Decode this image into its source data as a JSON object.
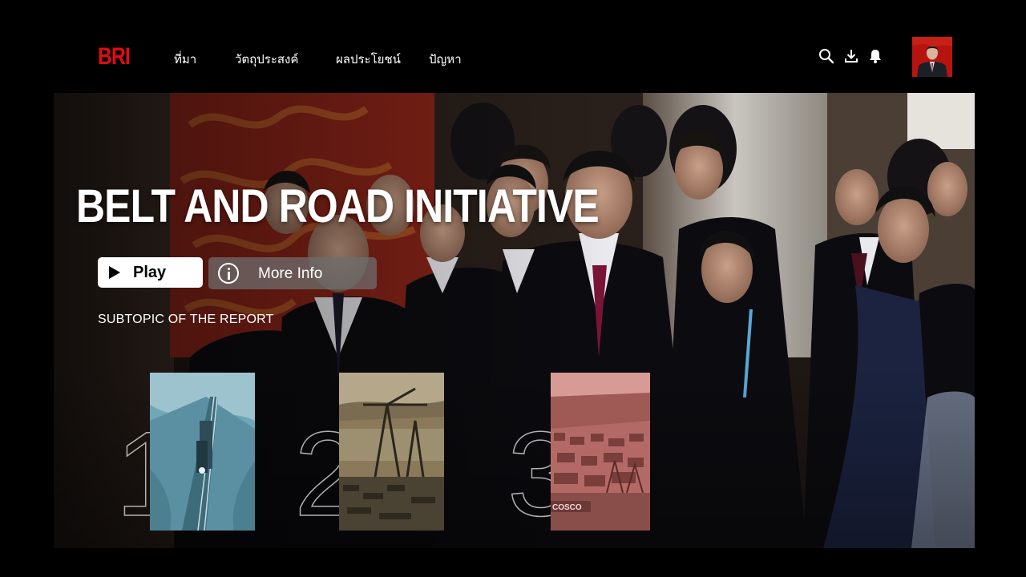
{
  "nav": {
    "logo": "BRI",
    "items": [
      {
        "label": "ที่มา"
      },
      {
        "label": "วัตถุประสงค์"
      },
      {
        "label": "ผลประโยชน์"
      },
      {
        "label": "ปัญหา"
      }
    ],
    "icons": [
      "search-icon",
      "download-icon",
      "bell-icon"
    ]
  },
  "hero": {
    "title": "BELT AND ROAD INITIATIVE",
    "play_label": "Play",
    "info_label": "More Info",
    "subtopic": "SUBTOPIC OF THE REPORT"
  },
  "cards": [
    {
      "number": "1",
      "theme": "railway",
      "tint": "#5d9cb0"
    },
    {
      "number": "2",
      "theme": "port-crane",
      "tint": "#8a7a5a"
    },
    {
      "number": "3",
      "theme": "container-port",
      "tint": "#b36a66",
      "caption": "COSCO"
    }
  ],
  "colors": {
    "brand": "#e50914",
    "background": "#000000"
  }
}
